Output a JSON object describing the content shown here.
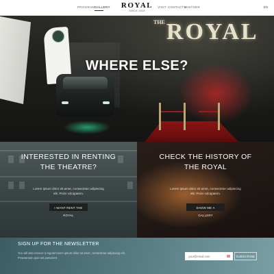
{
  "header": {
    "nav_left": [
      {
        "label": "PROGRAM"
      },
      {
        "label": "GALLERY"
      }
    ],
    "nav_right": [
      {
        "label": "VISIT"
      },
      {
        "label": "CONTACTS"
      },
      {
        "label": "WHITHER"
      }
    ],
    "active_item": "GALLERY",
    "logo": {
      "name": "ROYAL",
      "subtitle": "SINCE 1919"
    },
    "language": "EN"
  },
  "hero": {
    "title": "WHERE ELSE?",
    "sign_small": "THE",
    "sign_big": "ROYAL"
  },
  "cards": [
    {
      "title": "INTERESTED IN RENTING THE THEATRE?",
      "text": "Lorem ipsum dolor sit amet, consectetur adipiscing elit. Proin volutpatem.",
      "button": "I WANT RENT THE ROYAL"
    },
    {
      "title": "CHECK THE HISTORY OF THE ROYAL",
      "text": "Lorem ipsum dolor sit amet, consectetur adipiscing elit. Proin volutpatem.",
      "button": "SHOW ME A GALLERY"
    }
  ],
  "newsletter": {
    "title": "SIGN UP FOR THE NEWSLETTER",
    "text": "You will also receive a regular lorem ipsum dolor sit amet, consectetur adipiscing elit. Praesentum quis est parturient.",
    "input_placeholder": "your@email.com",
    "button": "SUBSCRIBE"
  },
  "colors": {
    "header_bg": "#ffffff",
    "button_bg": "#1f1f1f",
    "newsletter_bg": "#5b7f87",
    "carpet_red": "#8d1414"
  },
  "icons": [
    "email-status-icon"
  ]
}
